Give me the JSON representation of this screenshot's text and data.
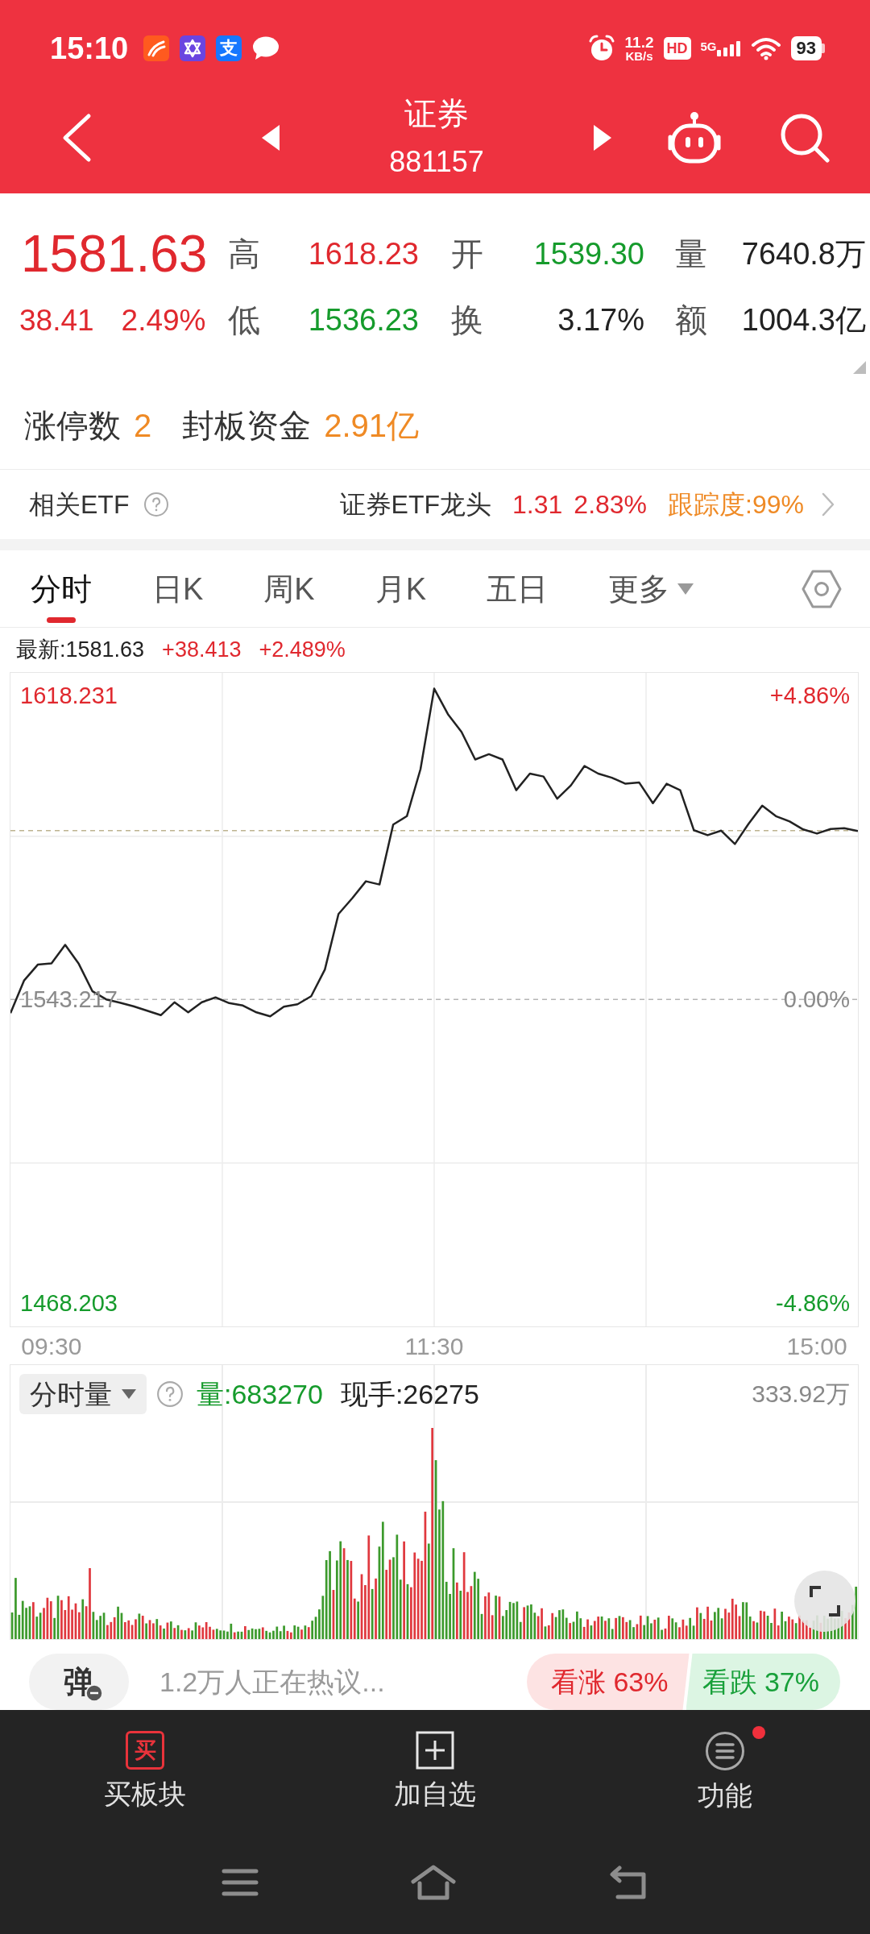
{
  "status_bar": {
    "time": "15:10",
    "app_glyph": "支",
    "speed": "11.2",
    "speed_unit": "KB/s",
    "hd": "HD",
    "network": "5G",
    "battery": "93"
  },
  "header": {
    "title": "证券",
    "code": "881157"
  },
  "quote": {
    "price": "1581.63",
    "change": "38.41",
    "change_pct": "2.49%",
    "color": "#e0282e",
    "stats": [
      {
        "label": "高",
        "value": "1618.23",
        "color": "#e0282e"
      },
      {
        "label": "开",
        "value": "1539.30",
        "color": "#169b2c"
      },
      {
        "label": "量",
        "value": "7640.8万",
        "color": "#222222"
      },
      {
        "label": "低",
        "value": "1536.23",
        "color": "#169b2c"
      },
      {
        "label": "换",
        "value": "3.17%",
        "color": "#222222"
      },
      {
        "label": "额",
        "value": "1004.3亿",
        "color": "#222222"
      }
    ]
  },
  "limit": [
    {
      "label": "涨停数",
      "value": "2"
    },
    {
      "label": "封板资金",
      "value": "2.91亿"
    }
  ],
  "related_etf": {
    "label": "相关ETF",
    "name": "证券ETF龙头",
    "price": "1.31",
    "change_pct": "2.83%",
    "tracking": "跟踪度:99%"
  },
  "tabs": [
    {
      "label": "分时",
      "selected": true,
      "kind": "tab"
    },
    {
      "label": "日K",
      "selected": false,
      "kind": "tab"
    },
    {
      "label": "周K",
      "selected": false,
      "kind": "tab"
    },
    {
      "label": "月K",
      "selected": false,
      "kind": "tab"
    },
    {
      "label": "五日",
      "selected": false,
      "kind": "tab"
    },
    {
      "label": "更多",
      "selected": false,
      "kind": "menu"
    }
  ],
  "latest": {
    "label": "最新:1581.63",
    "change": "+38.413",
    "change_pct": "+2.489%"
  },
  "price_chart": {
    "right_labels": [
      "+4.86%",
      "0.00%",
      "-4.86%"
    ],
    "chart_data": {
      "type": "line",
      "categories": [
        null,
        null,
        null,
        "09:30",
        null,
        null,
        null,
        null,
        null,
        null,
        null,
        null,
        null,
        null,
        null,
        null,
        null,
        null,
        null,
        null,
        null,
        null,
        null,
        null,
        null,
        null,
        null,
        null,
        null,
        null,
        null,
        "11:30",
        null,
        null,
        null,
        null,
        null,
        null,
        null,
        null,
        null,
        null,
        null,
        null,
        null,
        null,
        null,
        null,
        null,
        null,
        null,
        null,
        null,
        null,
        null,
        null,
        null,
        null,
        null,
        "15:00",
        null,
        null,
        null
      ],
      "series": [
        {
          "color": "#222222",
          "values": [
            1539.8,
            1547.9,
            1551.8,
            1552.1,
            1556.7,
            1552.0,
            1545.2,
            1543.2,
            1542.4,
            1541.5,
            1540.4,
            1539.3,
            1542.5,
            1540.0,
            1542.5,
            1543.7,
            1542.3,
            1541.7,
            1540.0,
            1539.0,
            1541.4,
            1542.0,
            1544.0,
            1550.6,
            1564.3,
            1568.2,
            1572.4,
            1571.6,
            1586.4,
            1588.5,
            1600.1,
            1620.0,
            1613.7,
            1609.3,
            1602.5,
            1603.8,
            1602.5,
            1594.9,
            1599.0,
            1598.3,
            1592.8,
            1596.1,
            1600.9,
            1599.0,
            1598.0,
            1596.5,
            1596.8,
            1591.7,
            1596.5,
            1594.9,
            1585.0,
            1583.8,
            1584.9,
            1581.6,
            1586.6,
            1591.1,
            1588.5,
            1587.2,
            1585.2,
            1584.2,
            1585.3,
            1585.5,
            1584.8
          ]
        }
      ],
      "ylim": [
        1462.4,
        1623.9
      ],
      "yticks": [
        {
          "value": 1618.231,
          "label": "1618.231"
        },
        {
          "value": 1543.217,
          "label": "1543.217"
        },
        {
          "value": 1468.203,
          "label": "1468.203"
        }
      ],
      "ref_lines": [
        {
          "axis": "y",
          "value": 1543.217,
          "color": "#b5b5b5"
        },
        {
          "axis": "y",
          "value": 1584.9,
          "color": "#bdb38f"
        }
      ]
    }
  },
  "volume_panel": {
    "selector": "分时量",
    "volume": "量:683270",
    "current": "现手:26275",
    "max": "333.92万"
  },
  "discussion": {
    "button": "弹",
    "prompt": "1.2万人正在热议...",
    "bull": "看涨 63%",
    "bear": "看跌 37%"
  },
  "bottom_tabs": [
    {
      "label": "买板块",
      "kind": "buy",
      "glyph": "买",
      "dot": false
    },
    {
      "label": "加自选",
      "kind": "add",
      "dot": false
    },
    {
      "label": "功能",
      "kind": "menu",
      "dot": true
    }
  ]
}
